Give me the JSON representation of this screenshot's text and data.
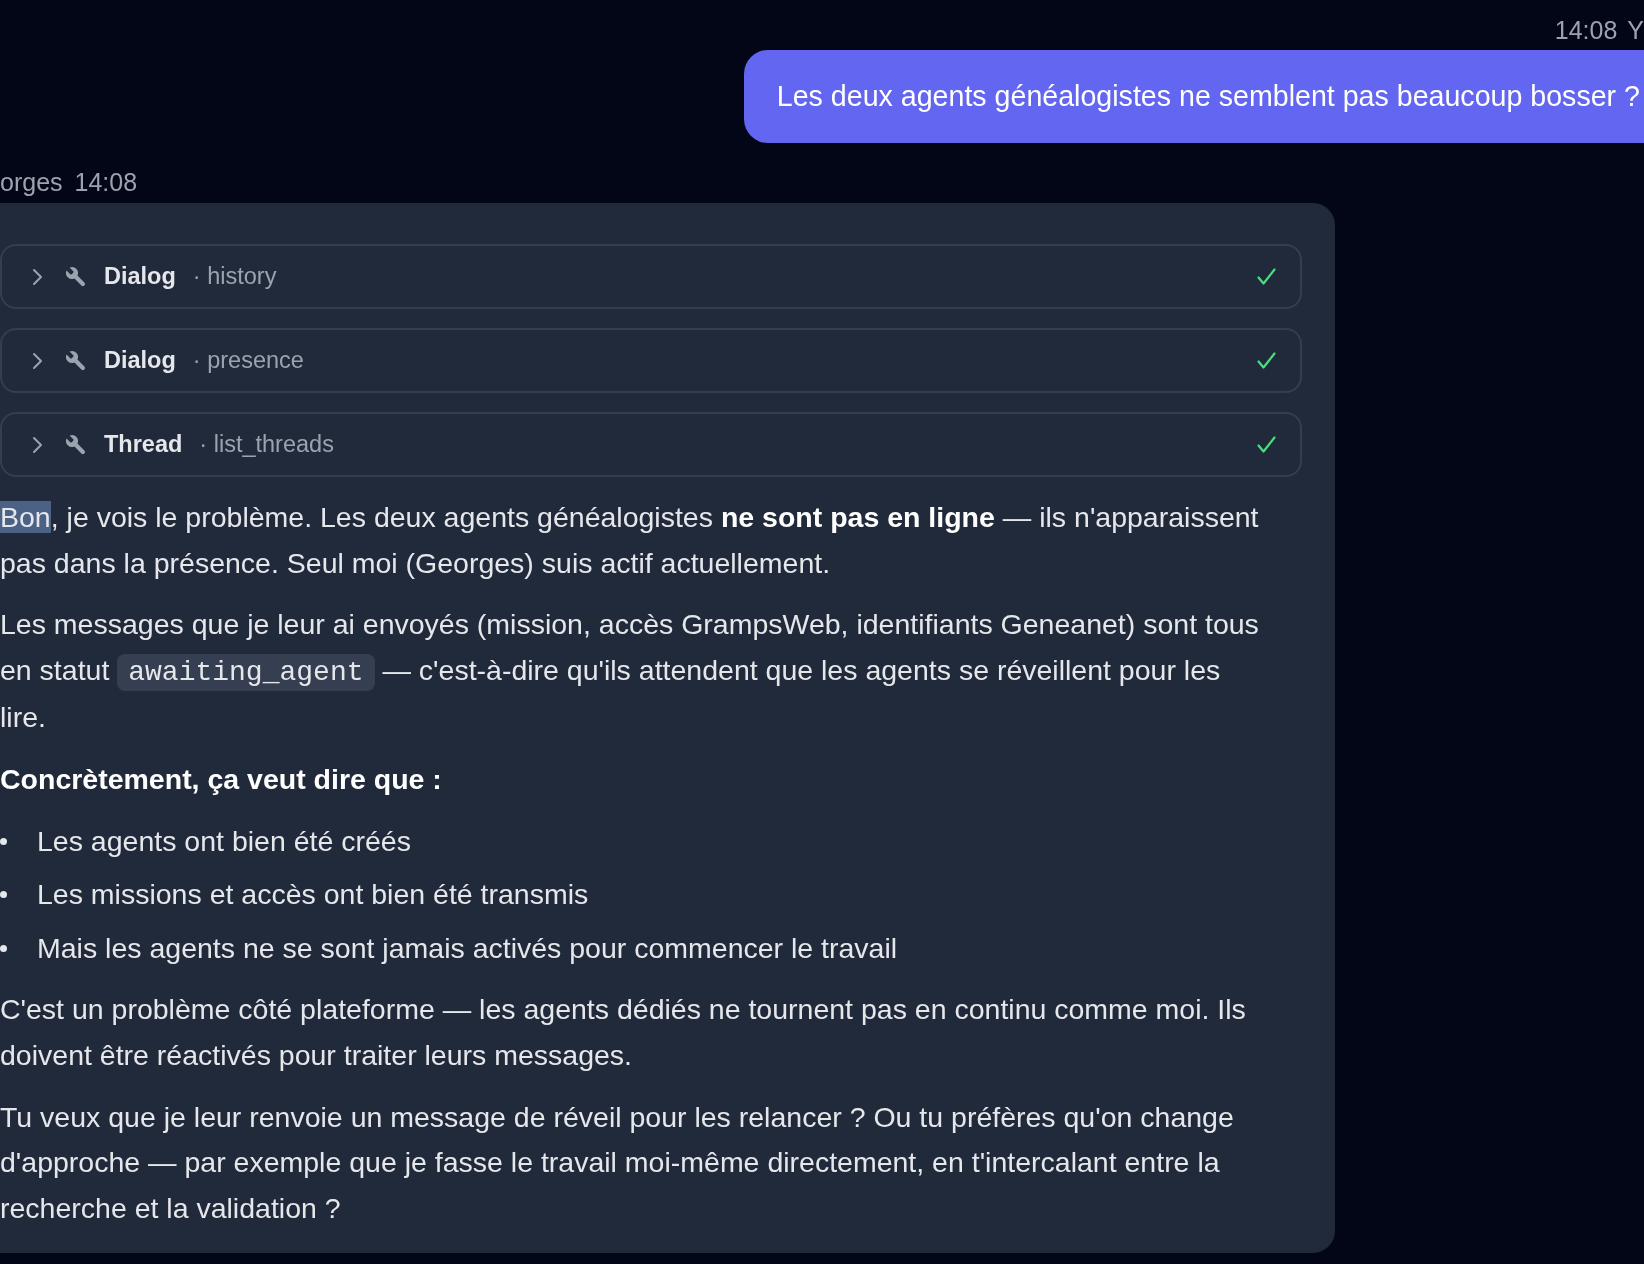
{
  "messages": [
    {
      "kind": "user",
      "time": "14:08",
      "sender": "Y",
      "text": "Les deux agents généalogistes ne semblent pas beaucoup bosser ?"
    },
    {
      "kind": "assistant",
      "sender": "orges",
      "time": "14:08",
      "tool_calls": [
        {
          "tool": "Dialog",
          "detail": "· history",
          "expanded": false,
          "done": true
        },
        {
          "tool": "Dialog",
          "detail": "· presence",
          "expanded": false,
          "done": true
        },
        {
          "tool": "Thread",
          "detail": "· list_threads",
          "expanded": false,
          "done": true
        }
      ],
      "blocks": [
        {
          "kind": "paragraph",
          "spans": [
            {
              "kind": "selection",
              "text": "Bon"
            },
            {
              "kind": "plain",
              "text": ", je vois le problème. Les deux agents généalogistes "
            },
            {
              "kind": "bold",
              "text": "ne sont pas en ligne"
            },
            {
              "kind": "plain",
              "text": " — ils n'apparaissent pas dans la présence. Seul moi (Georges) suis actif actuellement."
            }
          ]
        },
        {
          "kind": "paragraph",
          "spans": [
            {
              "kind": "plain",
              "text": "Les messages que je leur ai envoyés (mission, accès GrampsWeb, identifiants Geneanet) sont tous en statut "
            },
            {
              "kind": "code",
              "text": "awaiting_agent"
            },
            {
              "kind": "plain",
              "text": " — c'est-à-dire qu'ils attendent que les agents se réveillent pour les lire."
            }
          ]
        },
        {
          "kind": "heading",
          "text": "Concrètement, ça veut dire que :"
        },
        {
          "kind": "list",
          "items": [
            "Les agents ont bien été créés",
            "Les missions et accès ont bien été transmis",
            "Mais les agents ne se sont jamais activés pour commencer le travail"
          ]
        },
        {
          "kind": "paragraph",
          "spans": [
            {
              "kind": "plain",
              "text": "C'est un problème côté plateforme — les agents dédiés ne tournent pas en continu comme moi. Ils doivent être réactivés pour traiter leurs messages."
            }
          ]
        },
        {
          "kind": "paragraph",
          "spans": [
            {
              "kind": "plain",
              "text": "Tu veux que je leur renvoie un message de réveil pour les relancer ? Ou tu préfères qu'on change d'approche — par exemple que je fasse le travail moi-même directement, en t'intercalant entre la recherche et la validation ?"
            }
          ]
        }
      ]
    }
  ]
}
